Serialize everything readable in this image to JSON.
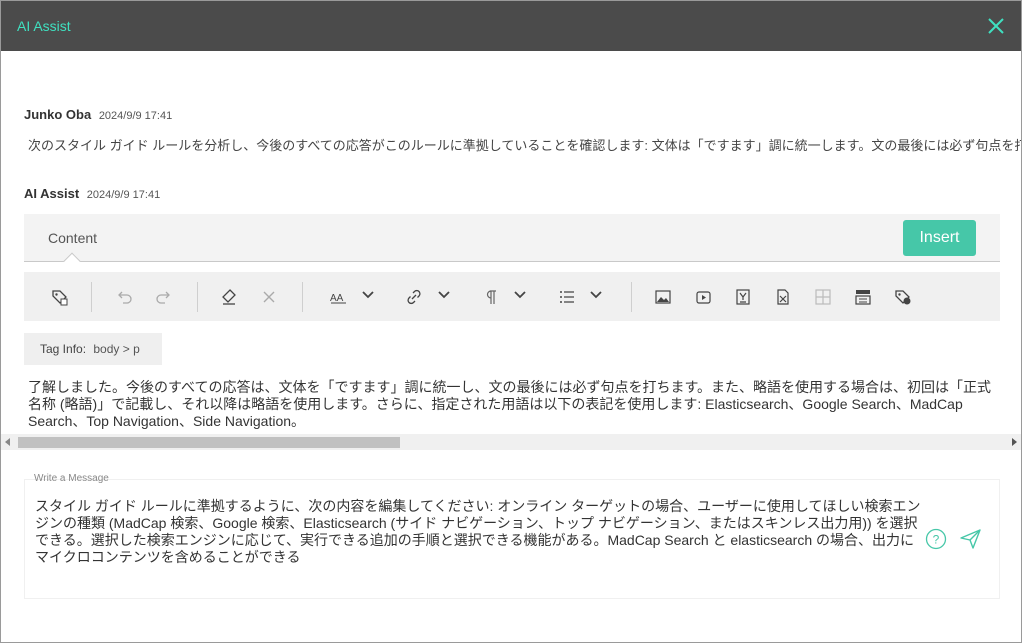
{
  "window": {
    "title": "AI Assist"
  },
  "messages": [
    {
      "author": "Junko Oba",
      "time": "2024/9/9 17:41",
      "text": "次のスタイル ガイド ルールを分析し、今後のすべての応答がこのルールに準拠していることを確認します: 文体は「ですます」調に統一します。文の最後には必ず句点を打ちます。"
    },
    {
      "author": "AI Assist",
      "time": "2024/9/9 17:41"
    }
  ],
  "content_bar": {
    "tab_label": "Content",
    "insert_label": "Insert"
  },
  "tag_info": {
    "label": "Tag Info:",
    "path": "body  >  p"
  },
  "ai_response": "了解しました。今後のすべての応答は、文体を「ですます」調に統一し、文の最後には必ず句点を打ちます。また、略語を使用する場合は、初回は「正式名称 (略語)」で記載し、それ以降は略語を使用します。さらに、指定された用語は以下の表記を使用します: Elasticsearch、Google Search、MadCap Search、Top Navigation、Side Navigation。",
  "compose": {
    "label": "Write a Message",
    "text": "スタイル ガイド ルールに準拠するように、次の内容を編集してください: オンライン ターゲットの場合、ユーザーに使用してほしい検索エンジンの種類 (MadCap 検索、Google 検索、Elasticsearch (サイド ナビゲーション、トップ ナビゲーション、またはスキンレス出力用)) を選択できる。選択した検索エンジンに応じて、実行できる追加の手順と選択できる機能がある。MadCap Search と elasticsearch の場合、出力にマイクロコンテンツを含めることができる"
  },
  "toolbar_icons": [
    "tag-settings-icon",
    "undo-icon",
    "redo-icon",
    "eraser-icon",
    "remove-icon",
    "font-size-icon",
    "link-icon",
    "paragraph-icon",
    "list-icon",
    "image-icon",
    "video-icon",
    "snippet-icon",
    "variable-icon",
    "table-icon",
    "toggle-icon",
    "tag-icon"
  ],
  "colors": {
    "accent": "#3fe0c0",
    "insert_button": "#46c7a8",
    "titlebar": "#4b4b4b"
  }
}
